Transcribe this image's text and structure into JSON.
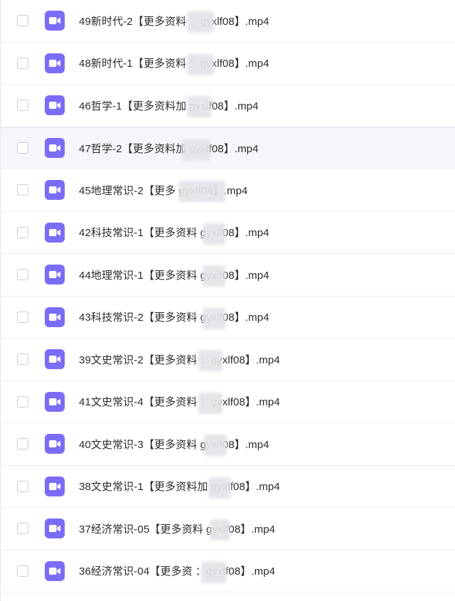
{
  "colors": {
    "icon_bg": "#7b6cf6",
    "icon_fg": "#ffffff",
    "hover_bg": "#f4f6fb"
  },
  "icons": {
    "file_type": "video-camera-icon"
  },
  "files": [
    {
      "name": "49新时代-2【更多资料        ：gyxlf08】.mp4"
    },
    {
      "name": "48新时代-1【更多资料        ：gyxlf08】.mp4"
    },
    {
      "name": "46哲学-1【更多资料加        gyxlf08】.mp4"
    },
    {
      "name": "47哲学-2【更多资料加        gyxlf08】.mp4"
    },
    {
      "name": "45地理常识-2【更多              gyxlf08】.mp4"
    },
    {
      "name": "42科技常识-1【更多资料          gyxlf08】.mp4"
    },
    {
      "name": "44地理常识-1【更多资料          gyxlf08】.mp4"
    },
    {
      "name": "43科技常识-2【更多资料          gyxlf08】.mp4"
    },
    {
      "name": "39文史常识-2【更多资料        ：gyxlf08】.mp4"
    },
    {
      "name": "41文史常识-4【更多资料        ：gyxlf08】.mp4"
    },
    {
      "name": "40文史常识-3【更多资料          gyxlf08】.mp4"
    },
    {
      "name": "38文史常识-1【更多资料加        gyxlf08】.mp4"
    },
    {
      "name": "37经济常识-05【更多资料          gyxlf08】.mp4"
    },
    {
      "name": "36经济常识-04【更多资        ：gyxlf08】.mp4"
    }
  ]
}
